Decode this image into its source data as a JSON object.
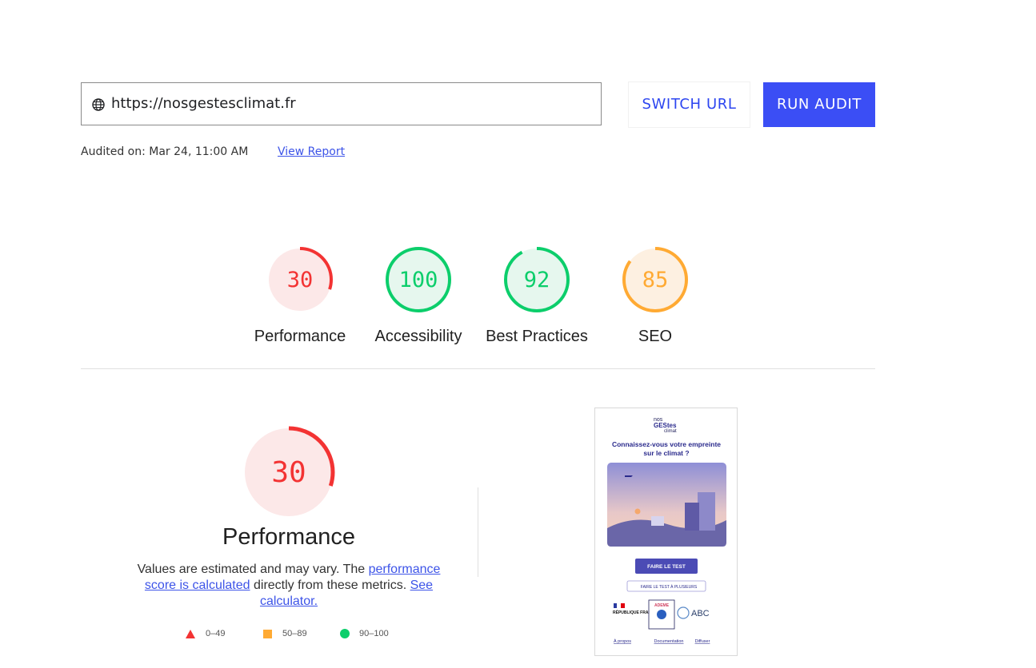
{
  "url_input": {
    "value": "https://nosgestesclimat.fr"
  },
  "buttons": {
    "switch_url": "SWITCH URL",
    "run_audit": "RUN AUDIT"
  },
  "audit": {
    "audited_on": "Audited on: Mar 24, 11:00 AM",
    "view_report": "View Report"
  },
  "scores": [
    {
      "label": "Performance",
      "score": "30",
      "value": 30,
      "status": "fail"
    },
    {
      "label": "Accessibility",
      "score": "100",
      "value": 100,
      "status": "pass"
    },
    {
      "label": "Best Practices",
      "score": "92",
      "value": 92,
      "status": "pass"
    },
    {
      "label": "SEO",
      "score": "85",
      "value": 85,
      "status": "average"
    }
  ],
  "colors": {
    "fail": "#f33333",
    "fail_bg": "#fce8e8",
    "average": "#ffaa33",
    "average_bg": "#fdf0e1",
    "pass": "#0cce6b",
    "pass_bg": "#e6f7ee",
    "accent": "#3b4ef5"
  },
  "performance_detail": {
    "score": "30",
    "value": 30,
    "title": "Performance",
    "desc_prefix": "Values are estimated and may vary. The ",
    "desc_link1": "performance score is calculated",
    "desc_mid": " directly from these metrics. ",
    "desc_link2": "See calculator."
  },
  "legend": [
    {
      "range": "0–49",
      "shape": "triangle",
      "color": "#f33333"
    },
    {
      "range": "50–89",
      "shape": "square",
      "color": "#ffaa33"
    },
    {
      "range": "90–100",
      "shape": "circle",
      "color": "#0cce6b"
    }
  ],
  "screenshot": {
    "logo_line1": "nos",
    "logo_line2": "GEStes",
    "logo_line3": "climat",
    "headline_1": "Connaissez-vous votre empreinte",
    "headline_2": "sur le climat ?",
    "cta": "FAIRE LE TEST",
    "cta2": "FAIRE LE TEST À PLUSIEURS",
    "partner_1": "RÉPUBLIQUE FRANÇAISE",
    "partner_2": "ADEME",
    "partner_3": "ABC",
    "footer_links": [
      "À propos",
      "Documentation",
      "Diffuser"
    ]
  },
  "icons": {
    "url_icon": "globe-icon"
  }
}
